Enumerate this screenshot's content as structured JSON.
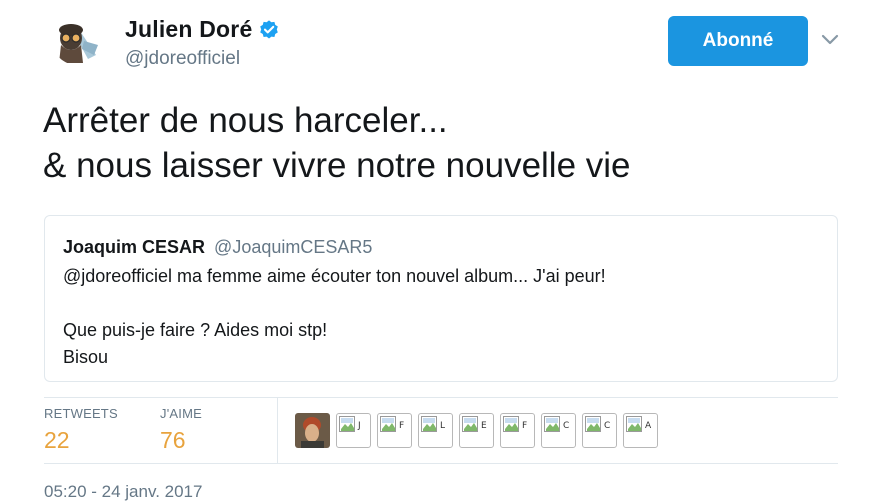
{
  "author": {
    "display_name": "Julien Doré",
    "handle": "@jdoreofficiel",
    "verified": true,
    "avatar_icon": "avatar-illustration-icon"
  },
  "actions": {
    "follow_label": "Abonné",
    "follow_color": "#1b95e0",
    "menu_icon": "chevron-down-icon"
  },
  "tweet": {
    "lines": [
      "Arrêter de nous harceler...",
      "& nous laisser vivre notre nouvelle vie"
    ]
  },
  "quoted_tweet": {
    "display_name": "Joaquim CESAR",
    "handle": "@JoaquimCESAR5",
    "lines": [
      "@jdoreofficiel ma femme aime écouter ton nouvel album... J'ai peur!",
      "",
      "Que puis-je faire ? Aides moi stp!",
      "Bisou"
    ]
  },
  "stats": {
    "retweets_label": "RETWEETS",
    "retweets_value": "22",
    "likes_label": "J'AIME",
    "likes_value": "76",
    "value_color": "#e8a33d"
  },
  "likers": [
    {
      "type": "avatar"
    },
    {
      "type": "broken",
      "alt": "J"
    },
    {
      "type": "broken",
      "alt": "F"
    },
    {
      "type": "broken",
      "alt": "L"
    },
    {
      "type": "broken",
      "alt": "E"
    },
    {
      "type": "broken",
      "alt": "F"
    },
    {
      "type": "broken",
      "alt": "C"
    },
    {
      "type": "broken",
      "alt": "C"
    },
    {
      "type": "broken",
      "alt": "A"
    }
  ],
  "timestamp": "05:20 - 24 janv. 2017"
}
